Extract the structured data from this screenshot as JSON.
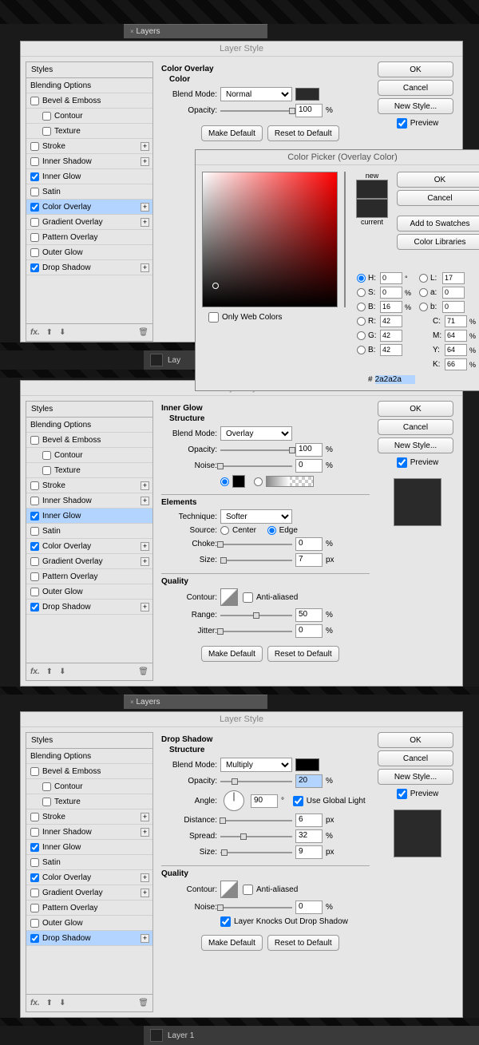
{
  "layers_panel": {
    "title": "Layers",
    "layer1": "Layer 1"
  },
  "dialog1": {
    "title": "Layer Style",
    "styles_header": "Styles",
    "blending_options": "Blending Options",
    "items": [
      {
        "label": "Bevel & Emboss",
        "checked": false,
        "plus": false,
        "indent": false
      },
      {
        "label": "Contour",
        "checked": false,
        "plus": false,
        "indent": true
      },
      {
        "label": "Texture",
        "checked": false,
        "plus": false,
        "indent": true
      },
      {
        "label": "Stroke",
        "checked": false,
        "plus": true,
        "indent": false
      },
      {
        "label": "Inner Shadow",
        "checked": false,
        "plus": true,
        "indent": false
      },
      {
        "label": "Inner Glow",
        "checked": true,
        "plus": false,
        "indent": false
      },
      {
        "label": "Satin",
        "checked": false,
        "plus": false,
        "indent": false
      },
      {
        "label": "Color Overlay",
        "checked": true,
        "plus": true,
        "indent": false,
        "active": true
      },
      {
        "label": "Gradient Overlay",
        "checked": false,
        "plus": true,
        "indent": false
      },
      {
        "label": "Pattern Overlay",
        "checked": false,
        "plus": false,
        "indent": false
      },
      {
        "label": "Outer Glow",
        "checked": false,
        "plus": false,
        "indent": false
      },
      {
        "label": "Drop Shadow",
        "checked": true,
        "plus": true,
        "indent": false
      }
    ],
    "section": "Color Overlay",
    "sub": "Color",
    "blend_mode_lbl": "Blend Mode:",
    "blend_mode_val": "Normal",
    "opacity_lbl": "Opacity:",
    "opacity_val": "100",
    "make_default": "Make Default",
    "reset_default": "Reset to Default",
    "ok": "OK",
    "cancel": "Cancel",
    "new_style": "New Style...",
    "preview": "Preview"
  },
  "picker": {
    "title": "Color Picker (Overlay Color)",
    "new": "new",
    "current": "current",
    "ok": "OK",
    "cancel": "Cancel",
    "add_swatches": "Add to Swatches",
    "color_libs": "Color Libraries",
    "only_web": "Only Web Colors",
    "H": "0",
    "S": "0",
    "Bv": "16",
    "R": "42",
    "G": "42",
    "B": "42",
    "L": "17",
    "a": "0",
    "b": "0",
    "C": "71",
    "M": "64",
    "Y": "64",
    "K": "66",
    "hex": "2a2a2a"
  },
  "dialog2": {
    "title": "Layer Style",
    "section": "Inner Glow",
    "sub1": "Structure",
    "blend_mode_lbl": "Blend Mode:",
    "blend_mode_val": "Overlay",
    "opacity_lbl": "Opacity:",
    "opacity_val": "100",
    "noise_lbl": "Noise:",
    "noise_val": "0",
    "sub2": "Elements",
    "technique_lbl": "Technique:",
    "technique_val": "Softer",
    "source_lbl": "Source:",
    "center": "Center",
    "edge": "Edge",
    "choke_lbl": "Choke:",
    "choke_val": "0",
    "size_lbl": "Size:",
    "size_val": "7",
    "sub3": "Quality",
    "contour_lbl": "Contour:",
    "anti_aliased": "Anti-aliased",
    "range_lbl": "Range:",
    "range_val": "50",
    "jitter_lbl": "Jitter:",
    "jitter_val": "0",
    "make_default": "Make Default",
    "reset_default": "Reset to Default",
    "ok": "OK",
    "cancel": "Cancel",
    "new_style": "New Style...",
    "preview": "Preview",
    "active_item": "Inner Glow"
  },
  "dialog3": {
    "title": "Layer Style",
    "section": "Drop Shadow",
    "sub1": "Structure",
    "blend_mode_lbl": "Blend Mode:",
    "blend_mode_val": "Multiply",
    "opacity_lbl": "Opacity:",
    "opacity_val": "20",
    "angle_lbl": "Angle:",
    "angle_val": "90",
    "global_light": "Use Global Light",
    "distance_lbl": "Distance:",
    "distance_val": "6",
    "spread_lbl": "Spread:",
    "spread_val": "32",
    "size_lbl": "Size:",
    "size_val": "9",
    "sub2": "Quality",
    "contour_lbl": "Contour:",
    "anti_aliased": "Anti-aliased",
    "noise_lbl": "Noise:",
    "noise_val": "0",
    "knocks_out": "Layer Knocks Out Drop Shadow",
    "make_default": "Make Default",
    "reset_default": "Reset to Default",
    "ok": "OK",
    "cancel": "Cancel",
    "new_style": "New Style...",
    "preview": "Preview",
    "active_item": "Drop Shadow"
  },
  "pct": "%",
  "px": "px",
  "deg": "°",
  "hash": "#"
}
